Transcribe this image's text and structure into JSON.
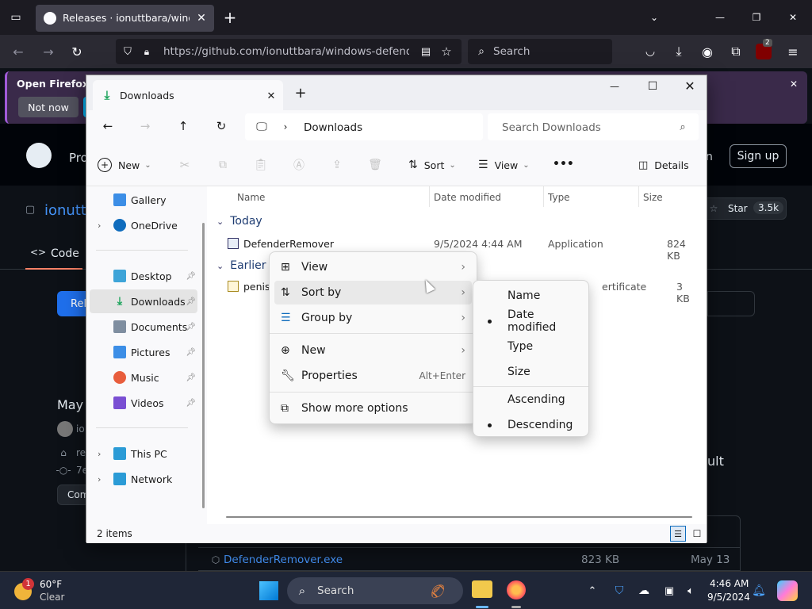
{
  "firefox": {
    "tab_title": "Releases · ionuttbara/windows-",
    "url": "https://github.com/ionuttbara/windows-defender-",
    "search_placeholder": "Search",
    "notif_text": "Open Firefox ev",
    "not_now": "Not now",
    "ublock_badge": "2"
  },
  "github": {
    "product_label": "Pro",
    "repo_name": "ionutt",
    "code_tab": "Code",
    "sign_in_partial": "n",
    "sign_up": "Sign up",
    "star_label": "Star",
    "star_count": "3.5k",
    "release_btn_partial": "Rel",
    "date_partial": "May",
    "author_partial": "io",
    "tag_partial": "re",
    "commit_partial": "7e",
    "compare_partial": "Com",
    "ult_partial": "ult",
    "asset_name": "DefenderRemover.exe",
    "asset_size": "823 KB",
    "asset_date": "May 13"
  },
  "explorer": {
    "tab_title": "Downloads",
    "breadcrumb": "Downloads",
    "search_placeholder": "Search Downloads",
    "toolbar": {
      "new": "New",
      "sort": "Sort",
      "view": "View",
      "more": "•••",
      "details": "Details"
    },
    "nav": [
      {
        "label": "Gallery",
        "color": "#3c8ee6"
      },
      {
        "label": "OneDrive",
        "color": "#0f6cbd"
      },
      {
        "label": "Desktop",
        "color": "#3ea4d8"
      },
      {
        "label": "Downloads",
        "color": "#1aa35a"
      },
      {
        "label": "Documents",
        "color": "#7f8ea0"
      },
      {
        "label": "Pictures",
        "color": "#3c8ee6"
      },
      {
        "label": "Music",
        "color": "#e85d3c"
      },
      {
        "label": "Videos",
        "color": "#7a4fd3"
      },
      {
        "label": "This PC",
        "color": "#2b9bd6"
      },
      {
        "label": "Network",
        "color": "#2b9bd6"
      }
    ],
    "columns": {
      "name": "Name",
      "date": "Date modified",
      "type": "Type",
      "size": "Size"
    },
    "groups": {
      "today": "Today",
      "earlier": "Earlier"
    },
    "files": [
      {
        "name": "DefenderRemover",
        "date": "9/5/2024 4:44 AM",
        "type": "Application",
        "size": "824 KB"
      },
      {
        "name": "penis",
        "date": "",
        "type": "ertificate",
        "size": "3 KB"
      }
    ],
    "status": "2 items"
  },
  "context_menu": {
    "view": "View",
    "sort_by": "Sort by",
    "group_by": "Group by",
    "new": "New",
    "properties": "Properties",
    "properties_shortcut": "Alt+Enter",
    "show_more": "Show more options"
  },
  "sort_submenu": {
    "name": "Name",
    "date_modified": "Date modified",
    "type": "Type",
    "size": "Size",
    "ascending": "Ascending",
    "descending": "Descending",
    "selected_field": "Date modified",
    "selected_order": "Descending"
  },
  "taskbar": {
    "weather_temp": "60°F",
    "weather_desc": "Clear",
    "weather_badge": "1",
    "search_placeholder": "Search",
    "time": "4:46 AM",
    "date": "9/5/2024"
  }
}
